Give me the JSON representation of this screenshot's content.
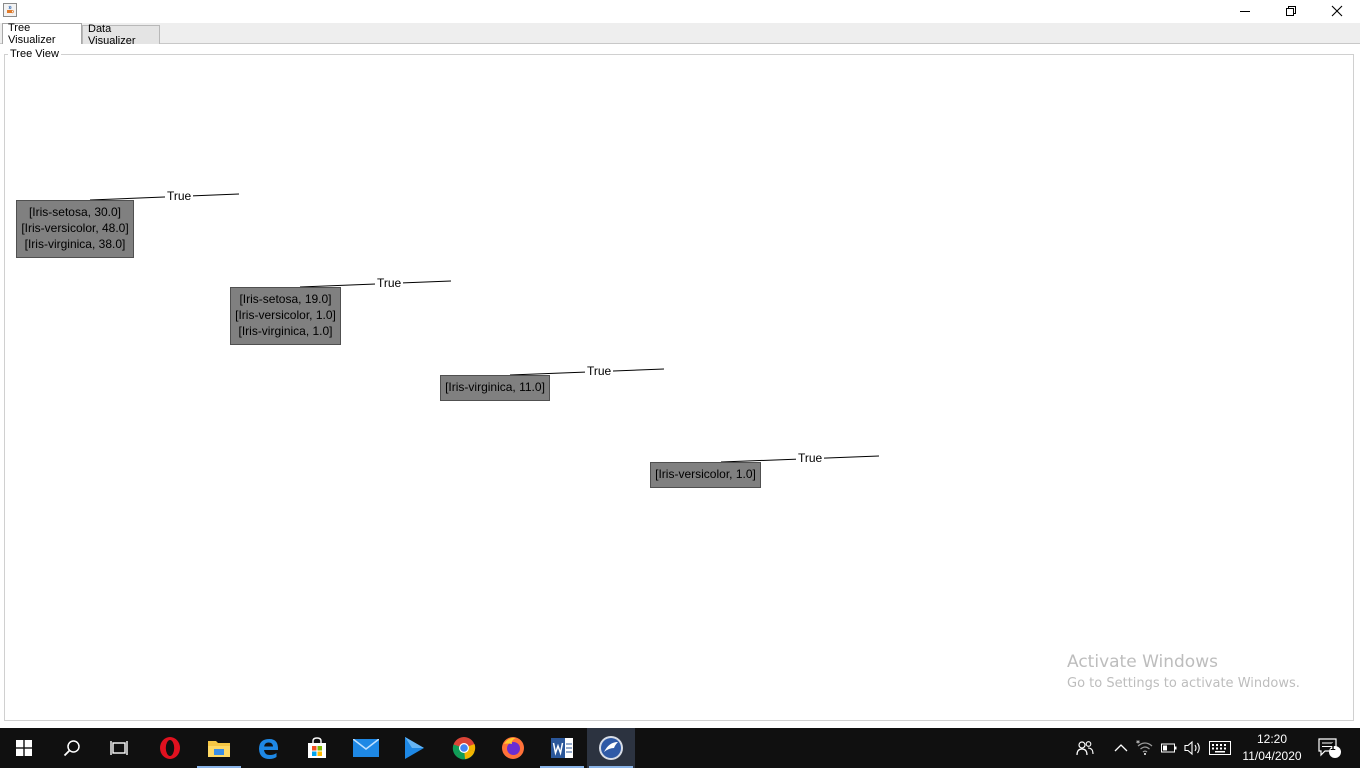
{
  "window": {
    "app_icon": "java-cup-icon",
    "controls": [
      "minimize-icon",
      "restore-icon",
      "close-icon"
    ]
  },
  "tabs": [
    {
      "label": "Tree Visualizer",
      "active": true
    },
    {
      "label": "Data Visualizer",
      "active": false
    }
  ],
  "panel": {
    "title": "Tree View"
  },
  "tree": {
    "node_color": "#808080",
    "edge_label": "True",
    "nodes": [
      {
        "lines": [
          "[Iris-setosa, 30.0]",
          "[Iris-versicolor, 48.0]",
          "[Iris-virginica, 38.0]"
        ]
      },
      {
        "lines": [
          "[Iris-setosa, 19.0]",
          "[Iris-versicolor, 1.0]",
          "[Iris-virginica, 1.0]"
        ]
      },
      {
        "lines": [
          "[Iris-virginica, 11.0]"
        ]
      },
      {
        "lines": [
          "[Iris-versicolor, 1.0]"
        ]
      }
    ],
    "edges": [
      "True",
      "True",
      "True",
      "True"
    ]
  },
  "watermark": {
    "line1": "Activate Windows",
    "line2": "Go to Settings to activate Windows."
  },
  "taskbar": {
    "apps": [
      "start-icon",
      "search-icon",
      "task-view-icon",
      "opera-icon",
      "file-explorer-icon",
      "edge-icon",
      "store-icon",
      "mail-icon",
      "media-player-icon",
      "chrome-icon",
      "firefox-icon",
      "word-icon",
      "weka-icon"
    ],
    "tray": [
      "people-icon",
      "chevron-up-icon",
      "wifi-icon",
      "battery-icon",
      "volume-icon",
      "keyboard-icon",
      "notification-icon"
    ],
    "time": "12:20",
    "date": "11/04/2020",
    "notification_count": "1"
  }
}
